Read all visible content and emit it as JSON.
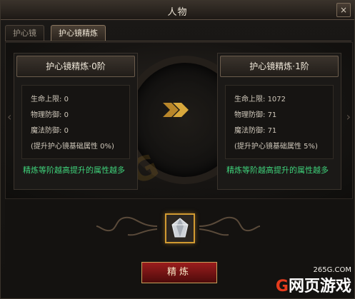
{
  "window": {
    "title": "人物",
    "close_symbol": "×"
  },
  "tabs": [
    {
      "label": "护心镜",
      "active": false
    },
    {
      "label": "护心镜精炼",
      "active": true
    }
  ],
  "left_panel": {
    "header": "护心镜精炼·0阶",
    "stats": [
      {
        "label": "生命上限",
        "value": "0"
      },
      {
        "label": "物理防御",
        "value": "0"
      },
      {
        "label": "魔法防御",
        "value": "0"
      }
    ],
    "bonus": "(提升护心镜基础属性 0%)",
    "note": "精炼等阶越高提升的属性越多"
  },
  "right_panel": {
    "header": "护心镜精炼·1阶",
    "stats": [
      {
        "label": "生命上限",
        "value": "1072"
      },
      {
        "label": "物理防御",
        "value": "71"
      },
      {
        "label": "魔法防御",
        "value": "71"
      }
    ],
    "bonus": "(提升护心镜基础属性 5%)",
    "note": "精炼等阶越高提升的属性越多"
  },
  "refine_button": {
    "label": "精炼"
  },
  "watermark": {
    "url": "265G.COM",
    "logo_g": "G",
    "logo_text": "网页游戏"
  },
  "colors": {
    "accent_green": "#3fd27b",
    "button_red": "#9b1d1d",
    "gold": "#d19a31"
  },
  "icons": {
    "arrow": "double-chevron-right",
    "item": "crystal-gem"
  }
}
